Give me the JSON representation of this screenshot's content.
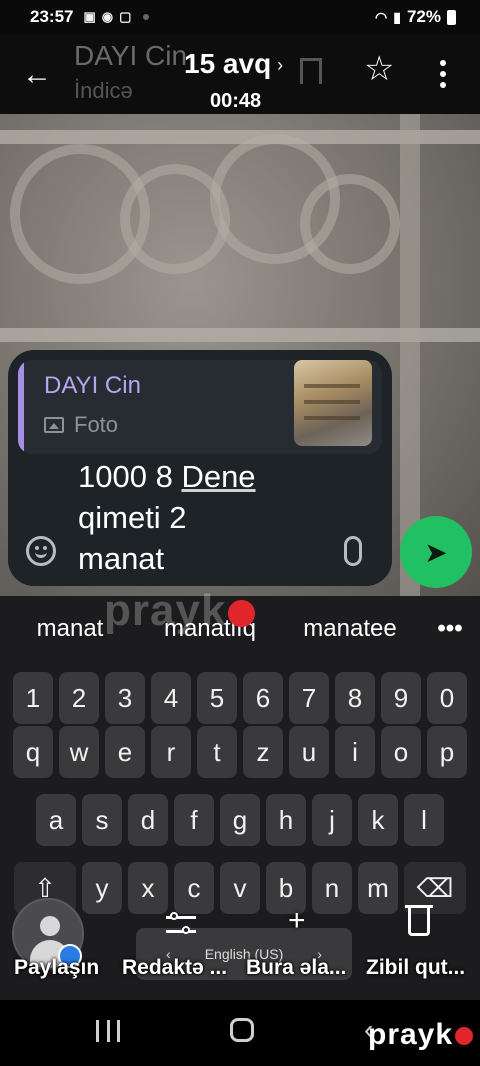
{
  "status_bar": {
    "time": "23:57",
    "battery": "72%"
  },
  "header": {
    "back_icon": "arrow-left-icon",
    "ghost_name": "DAYI Cin",
    "ghost_subtitle": "İndicə",
    "date": "15 avq",
    "date_chevron": "›",
    "time": "00:48"
  },
  "reply": {
    "quote_name": "DAYI Cin",
    "quote_type": "Foto",
    "message_line1": "1000 8 ",
    "message_word_underlined": "Dene",
    "message_line2": "qimeti 2",
    "message_line3": "manat"
  },
  "suggestions": [
    "manat",
    "manatlıq",
    "manatee"
  ],
  "suggestions_more": "•••",
  "keyboard": {
    "numbers": [
      "1",
      "2",
      "3",
      "4",
      "5",
      "6",
      "7",
      "8",
      "9",
      "0"
    ],
    "row1": [
      "q",
      "w",
      "e",
      "r",
      "t",
      "z",
      "u",
      "i",
      "o",
      "p"
    ],
    "row2": [
      "a",
      "s",
      "d",
      "f",
      "g",
      "h",
      "j",
      "k",
      "l"
    ],
    "row3": [
      "y",
      "x",
      "c",
      "v",
      "b",
      "n",
      "m"
    ],
    "shift": "⇧",
    "backspace": "⌫",
    "space_label": "English (US)",
    "space_left": "‹",
    "space_right": "›"
  },
  "actions": {
    "share": "Paylaşın",
    "edit": "Redaktə ...",
    "add": "Bura əla...",
    "delete": "Zibil qut...",
    "add_icon": "+"
  },
  "watermark": {
    "text": "prayk"
  },
  "colors": {
    "accent": "#21c063",
    "quote": "#b6a5f0",
    "bubble": "#1e2328"
  }
}
